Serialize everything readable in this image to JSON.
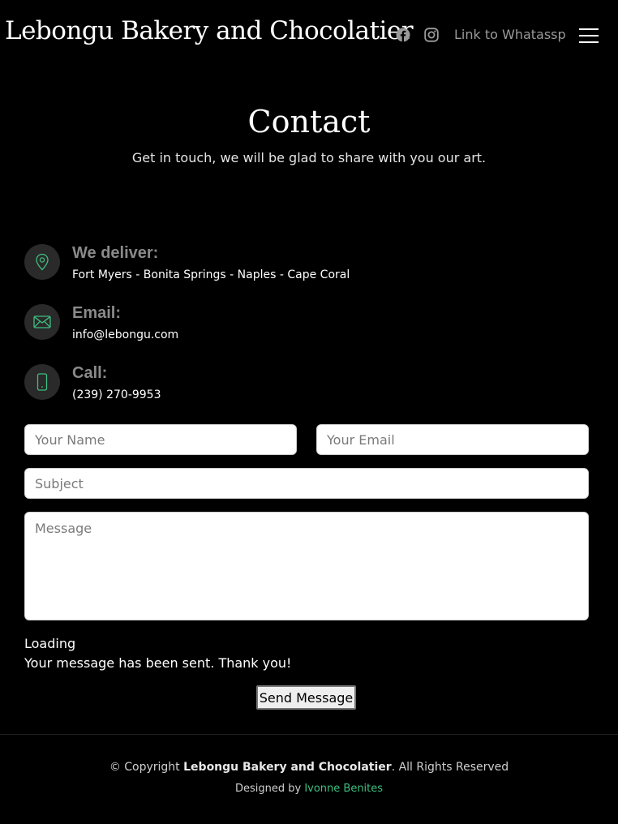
{
  "header": {
    "logo": "Lebongu Bakery and Chocolatier",
    "social_icons": [
      "facebook-icon",
      "instagram-icon"
    ],
    "whatsapp_link": "Link to Whatassp",
    "menu_icon": "hamburger-menu-icon"
  },
  "hero": {
    "title": "Contact",
    "subtitle": "Get in touch, we will be glad to share with you our art."
  },
  "info": [
    {
      "label": "We deliver:",
      "value": "Fort Myers - Bonita Springs - Naples - Cape Coral",
      "icon": "map-pin-icon"
    },
    {
      "label": "Email:",
      "value": "info@lebongu.com",
      "icon": "envelope-icon"
    },
    {
      "label": "Call:",
      "value": "(239) 270-9953",
      "icon": "phone-icon"
    }
  ],
  "form": {
    "name_placeholder": "Your Name",
    "email_placeholder": "Your Email",
    "subject_placeholder": "Subject",
    "message_placeholder": "Message",
    "loading_text": "Loading",
    "sent_message": "Your message has been sent. Thank you!",
    "submit_label": "Send Message"
  },
  "footer": {
    "copyright_prefix": "© Copyright",
    "company": "Lebongu Bakery and Chocolatier",
    "rights": ". All Rights Reserved",
    "designed_by": "Designed by",
    "designer": "Ivonne Benites"
  },
  "colors": {
    "background": "#000000",
    "accent": "#3fbf80",
    "icon_circle": "#2a2a2a",
    "label_gray": "#8a8a8a"
  }
}
